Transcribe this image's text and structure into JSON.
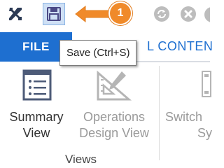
{
  "quick_access": {
    "items": [
      {
        "icon": "tools-icon"
      },
      {
        "icon": "save-icon",
        "state": "hover"
      },
      {
        "icon": "refresh-icon",
        "state": "disabled"
      },
      {
        "icon": "close-icon",
        "state": "disabled"
      },
      {
        "icon": "settings-icon",
        "state": "disabled"
      }
    ]
  },
  "callout": {
    "number": "1",
    "color": "#f08a2a"
  },
  "tabs": {
    "file_label": "FILE",
    "other_label": "L CONTEN",
    "file_color": "#1e6fd0"
  },
  "tooltip": {
    "text": "Save (Ctrl+S)"
  },
  "ribbon": {
    "buttons": [
      {
        "label_line1": "Summary",
        "label_line2": "View",
        "icon": "summary-view-icon",
        "enabled": true
      },
      {
        "label_line1": "Operations",
        "label_line2": "Design View",
        "icon": "design-view-icon",
        "enabled": false
      },
      {
        "label_line1": "Switch",
        "label_line2": "Sy",
        "icon": "switch-icon",
        "enabled": false
      }
    ],
    "group_label": "Views"
  }
}
